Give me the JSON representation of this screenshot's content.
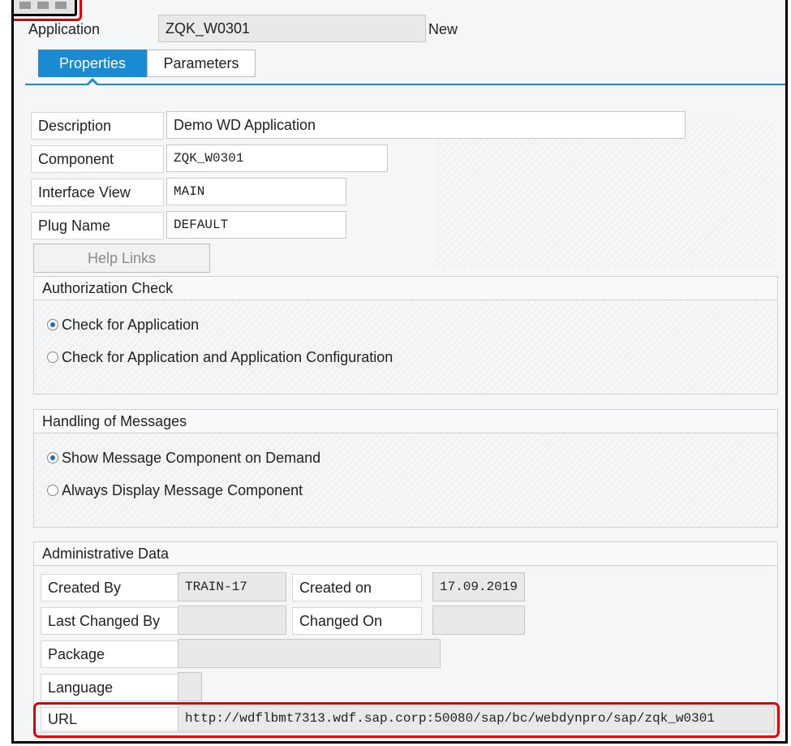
{
  "header": {
    "application_label": "Application",
    "application_value": "ZQK_W0301",
    "status": "New"
  },
  "tabs": [
    {
      "label": "Properties",
      "active": true
    },
    {
      "label": "Parameters",
      "active": false
    }
  ],
  "properties": {
    "description_label": "Description",
    "description_value": "Demo WD Application",
    "component_label": "Component",
    "component_value": "ZQK_W0301",
    "interface_view_label": "Interface View",
    "interface_view_value": "MAIN",
    "plug_name_label": "Plug Name",
    "plug_name_value": "DEFAULT",
    "help_links_label": "Help Links"
  },
  "authorization": {
    "title": "Authorization Check",
    "options": [
      {
        "label": "Check for Application",
        "selected": true
      },
      {
        "label": "Check for Application and Application Configuration",
        "selected": false
      }
    ]
  },
  "messages": {
    "title": "Handling of Messages",
    "options": [
      {
        "label": "Show Message Component on Demand",
        "selected": true
      },
      {
        "label": "Always Display Message Component",
        "selected": false
      }
    ]
  },
  "admin": {
    "title": "Administrative Data",
    "created_by_label": "Created By",
    "created_by_value": "TRAIN-17",
    "created_on_label": "Created on",
    "created_on_value": "17.09.2019",
    "last_changed_by_label": "Last Changed By",
    "last_changed_by_value": "",
    "changed_on_label": "Changed On",
    "changed_on_value": "",
    "package_label": "Package",
    "package_value": "",
    "language_label": "Language",
    "language_value": "",
    "url_label": "URL",
    "url_value": "http://wdflbmt7313.wdf.sap.corp:50080/sap/bc/webdynpro/sap/zqk_w0301"
  },
  "colors": {
    "accent": "#1a8bd2",
    "highlight": "#e00000",
    "readonly_bg": "#e9e9e9"
  }
}
